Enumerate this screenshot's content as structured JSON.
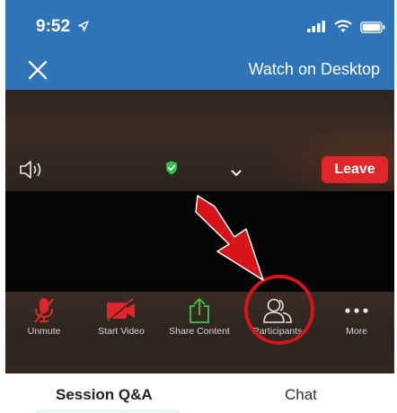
{
  "status_bar": {
    "time": "9:52"
  },
  "header": {
    "watch_label": "Watch on Desktop"
  },
  "meeting": {
    "leave_label": "Leave"
  },
  "toolbar": {
    "items": [
      {
        "label": "Unmute",
        "icon": "microphone-muted-icon"
      },
      {
        "label": "Start Video",
        "icon": "video-camera-off-icon"
      },
      {
        "label": "Share Content",
        "icon": "share-upload-icon"
      },
      {
        "label": "Participants",
        "icon": "participants-icon"
      },
      {
        "label": "More",
        "icon": "more-dots-icon"
      }
    ]
  },
  "tabs": [
    {
      "label": "Session Q&A",
      "active": true
    },
    {
      "label": "Chat",
      "active": false
    }
  ],
  "colors": {
    "header_blue": "#2f73b9",
    "leave_red": "#e0262a",
    "muted_red": "#e0262a",
    "share_green": "#3ec546",
    "annotation_red": "#d8141b"
  }
}
